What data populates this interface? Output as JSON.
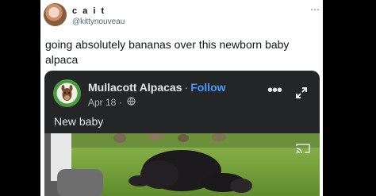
{
  "tweet": {
    "author_name": "c a i t",
    "author_handle": "@kittynouveau",
    "more_icon": "more-horizontal-icon",
    "text": "going absolutely bananas over this newborn baby alpaca"
  },
  "embed": {
    "page_name": "Mullacott Alpacas",
    "separator": "·",
    "follow_label": "Follow",
    "date": "Apr 18 ·",
    "globe_icon": "globe-icon",
    "post_text": "New baby",
    "colors": {
      "background": "#242526",
      "follow": "#4599ff",
      "grass": "#7aa53e"
    }
  }
}
